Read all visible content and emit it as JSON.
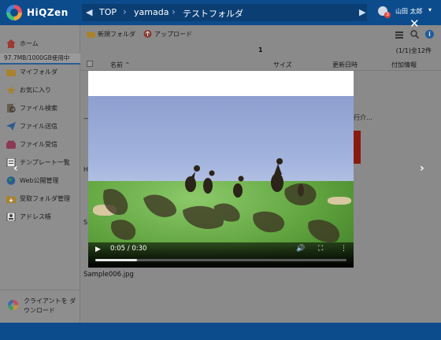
{
  "app": {
    "logo_text": "HiQZen"
  },
  "breadcrumb": {
    "items": [
      "TOP",
      "yamada",
      "テストフォルダ"
    ]
  },
  "user": {
    "name": "山田 太郎",
    "badge_count": "3"
  },
  "sidebar": {
    "items": [
      {
        "label": "ホーム",
        "icon": "home-icon",
        "color": "#c0443a"
      },
      {
        "label": "マイフォルダ",
        "icon": "folder-icon",
        "color": "#d6a33a"
      },
      {
        "label": "お気に入り",
        "icon": "star-icon",
        "color": "#d6a33a"
      },
      {
        "label": "ファイル検索",
        "icon": "file-search-icon",
        "color": "#7a6a55"
      },
      {
        "label": "ファイル送信",
        "icon": "send-icon",
        "color": "#2a6cb0"
      },
      {
        "label": "ファイル受信",
        "icon": "receive-icon",
        "color": "#b04060"
      },
      {
        "label": "テンプレート一覧",
        "icon": "template-icon",
        "color": "#5a5a5a"
      },
      {
        "label": "Web公開管理",
        "icon": "globe-icon",
        "color": "#2a6cb0"
      },
      {
        "label": "受取フォルダ管理",
        "icon": "inbox-folder-icon",
        "color": "#d6a33a"
      },
      {
        "label": "アドレス帳",
        "icon": "address-book-icon",
        "color": "#5a5a5a"
      }
    ],
    "storage": "97.7MB/1000GB使用中",
    "client_download": "クライアントを ダウンロード"
  },
  "toolbar": {
    "new_folder": "新規フォルダ",
    "upload": "アップロード"
  },
  "pager": {
    "current": "1",
    "info": "(1/1)全12件"
  },
  "list_header": {
    "name": "名前",
    "size": "サイズ",
    "updated": "更新日時",
    "extra": "付加情報"
  },
  "background_fragments": {
    "row_text": "行介…",
    "left_h": "H",
    "left_s": "S",
    "dash": "—"
  },
  "viewer": {
    "filename": "Sample006.jpg",
    "time": "0:05 / 0:30",
    "progress": 0.167,
    "close": "✕",
    "prev": "‹",
    "next": "›"
  },
  "colors": {
    "accent": "#0c4c8c",
    "badge": "#e8453c"
  }
}
